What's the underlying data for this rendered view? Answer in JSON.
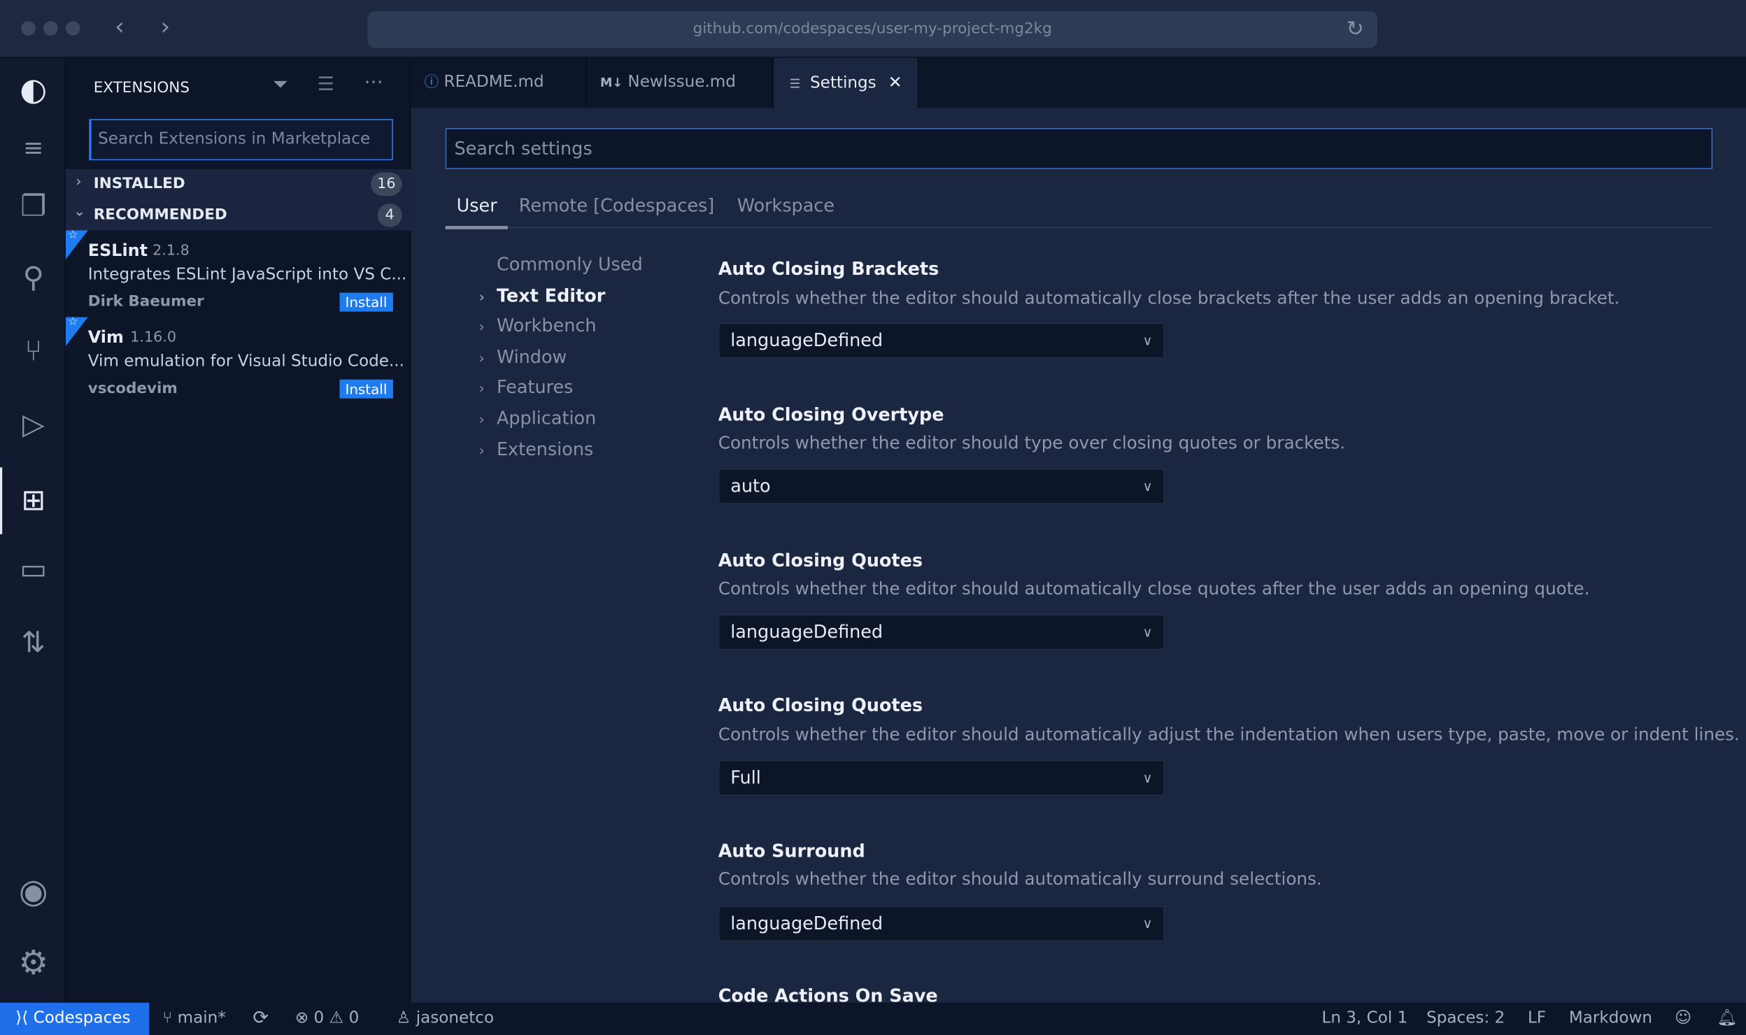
{
  "browser": {
    "url": "github.com/codespaces/user-my-project-mg2kg"
  },
  "sidebar": {
    "title": "EXTENSIONS",
    "search_placeholder": "Search Extensions in Marketplace",
    "sections": [
      {
        "label": "INSTALLED",
        "count": "16",
        "expanded": false
      },
      {
        "label": "RECOMMENDED",
        "count": "4",
        "expanded": true
      }
    ],
    "extensions": [
      {
        "name": "ESLint",
        "version": "2.1.8",
        "description": "Integrates ESLint JavaScript into VS C...",
        "publisher": "Dirk Baeumer",
        "action": "Install"
      },
      {
        "name": "Vim",
        "version": "1.16.0",
        "description": "Vim emulation for Visual Studio Code...",
        "publisher": "vscodevim",
        "action": "Install"
      }
    ]
  },
  "tabs": [
    {
      "label": "README.md",
      "icon": "info-icon"
    },
    {
      "label": "NewIssue.md",
      "icon": "markdown-icon"
    },
    {
      "label": "Settings",
      "icon": "settings-list-icon",
      "active": true
    }
  ],
  "settings": {
    "search_placeholder": "Search settings",
    "scopes": [
      "User",
      "Remote [Codespaces]",
      "Workspace"
    ],
    "active_scope": "User",
    "toc": [
      "Commonly Used",
      "Text Editor",
      "Workbench",
      "Window",
      "Features",
      "Application",
      "Extensions"
    ],
    "items": [
      {
        "title": "Auto Closing Brackets",
        "description": "Controls whether the editor should automatically close brackets after the user adds an opening bracket.",
        "value": "languageDefined"
      },
      {
        "title": "Auto Closing Overtype",
        "description": "Controls whether the editor should type over closing quotes or brackets.",
        "value": "auto"
      },
      {
        "title": "Auto Closing Quotes",
        "description": "Controls whether the editor should automatically close quotes after the user adds an opening quote.",
        "value": "languageDefined"
      },
      {
        "title": "Auto Closing Quotes",
        "description": "Controls whether the editor should automatically adjust the indentation when users type, paste, move or indent lines.",
        "value": "Full"
      },
      {
        "title": "Auto Surround",
        "description": "Controls whether the editor should automatically surround selections.",
        "value": "languageDefined"
      },
      {
        "title": "Code Actions On Save"
      }
    ]
  },
  "statusbar": {
    "remote": "Codespaces",
    "branch": "main*",
    "errors": "0",
    "warnings": "0",
    "user": "jasonetco",
    "position": "Ln 3, Col 1",
    "spaces": "Spaces: 2",
    "eol": "LF",
    "language": "Markdown"
  },
  "colors": {
    "accent": "#1f7cf0",
    "background": "#1b2640",
    "sidebar": "#0d1629"
  }
}
